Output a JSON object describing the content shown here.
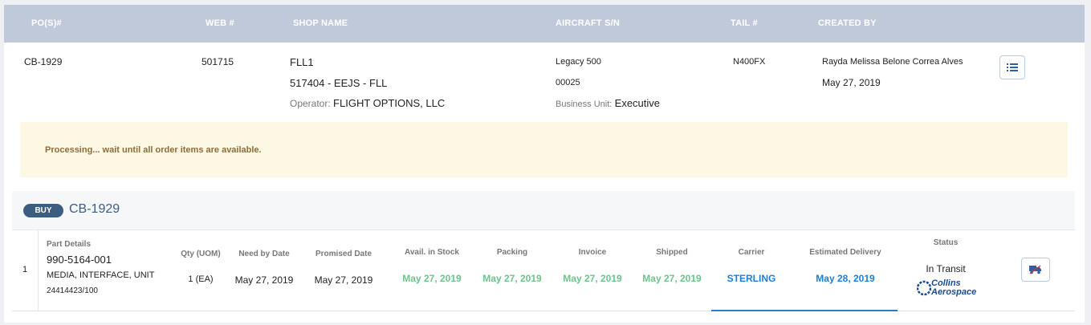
{
  "columns": {
    "pos": "PO(S)#",
    "web": "WEB #",
    "shop": "SHOP NAME",
    "aircraft": "AIRCRAFT S/N",
    "tail": "TAIL #",
    "created": "CREATED BY"
  },
  "order": {
    "po": "CB-1929",
    "web": "501715",
    "shop_name": "FLL1",
    "shop_code": "517404 - EEJS - FLL",
    "operator_label": "Operator:",
    "operator_value": "FLIGHT OPTIONS, LLC",
    "aircraft_model": "Legacy 500",
    "aircraft_sn": "00025",
    "business_unit_label": "Business Unit:",
    "business_unit_value": "Executive",
    "tail": "N400FX",
    "created_by": "Rayda Melissa Belone Correa Alves",
    "created_date": "May 27, 2019",
    "list_icon": "list-icon"
  },
  "alert": {
    "message": "Processing... wait until all order items are available."
  },
  "order_section": {
    "badge": "BUY",
    "title": "CB-1929"
  },
  "item_headers": {
    "part": "Part Details",
    "qty": "Qty (UOM)",
    "need": "Need by Date",
    "promised": "Promised Date",
    "stock": "Avail. in Stock",
    "packing": "Packing",
    "invoice": "Invoice",
    "shipped": "Shipped",
    "carrier": "Carrier",
    "est": "Estimated Delivery",
    "status": "Status"
  },
  "item": {
    "index": "1",
    "part_number": "990-5164-001",
    "description": "MEDIA, INTERFACE, UNIT",
    "serial": "24414423/100",
    "qty": "1 (EA)",
    "need_date": "May 27, 2019",
    "promised_date": "May 27, 2019",
    "stock_date": "May 27, 2019",
    "packing_date": "May 27, 2019",
    "invoice_date": "May 27, 2019",
    "shipped_date": "May 27, 2019",
    "carrier": "STERLING",
    "est_delivery": "May 28, 2019",
    "status": "In Transit",
    "logo_line1": "Collins",
    "logo_line2": "Aerospace",
    "truck_icon": "truck-icon"
  },
  "colors": {
    "header_bg": "#c0c9d9",
    "alert_bg": "#fcf8e3",
    "green": "#6cc48c",
    "blue": "#1b7fd6",
    "badge": "#3b5d82"
  }
}
